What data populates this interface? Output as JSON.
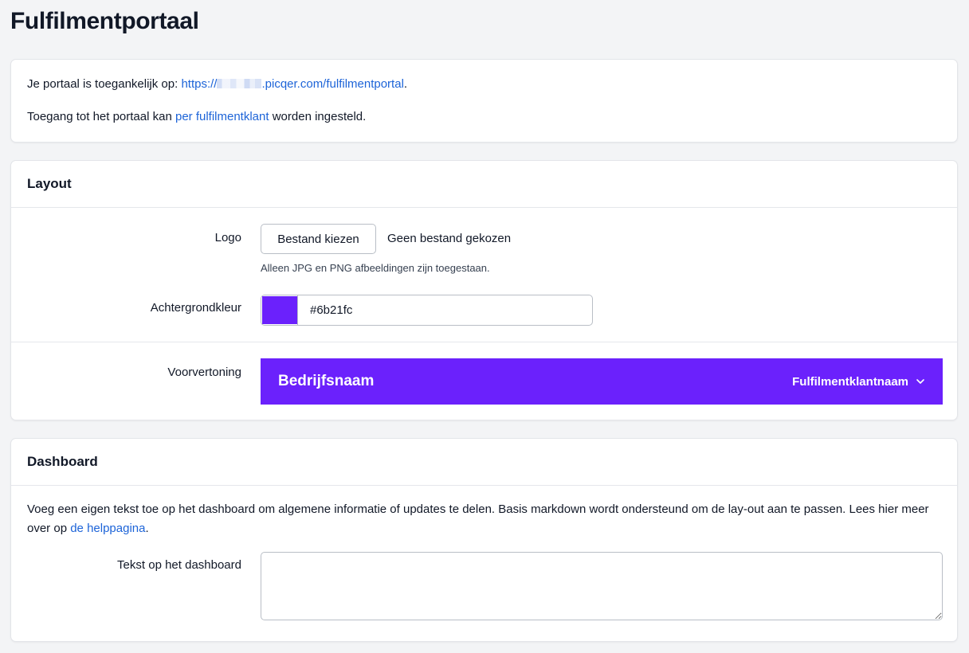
{
  "page": {
    "title": "Fulfilmentportaal"
  },
  "intro": {
    "line1_prefix": "Je portaal is toegankelijk op:",
    "url_start": "https://",
    "url_end": ".picqer.com/fulfilmentportal",
    "line1_suffix": ".",
    "line2_prefix": "Toegang tot het portaal kan",
    "line2_link": "per fulfilmentklant",
    "line2_suffix": "worden ingesteld."
  },
  "layout": {
    "header": "Layout",
    "logo_label": "Logo",
    "file_button_label": "Bestand kiezen",
    "file_status": "Geen bestand gekozen",
    "file_help": "Alleen JPG en PNG afbeeldingen zijn toegestaan.",
    "bg_color_label": "Achtergrondkleur",
    "bg_color_value": "#6b21fc",
    "preview_label": "Voorvertoning",
    "preview_company": "Bedrijfsnaam",
    "preview_client": "Fulfilmentklantnaam",
    "preview_client_icon": "chevron-down-icon"
  },
  "dashboard": {
    "header": "Dashboard",
    "description": "Voeg een eigen tekst toe op het dashboard om algemene informatie of updates te delen. Basis markdown wordt ondersteund om de lay-out aan te passen. Lees hier meer over op",
    "help_link": "de helppagina",
    "description_suffix": ".",
    "text_label": "Tekst op het dashboard",
    "text_value": ""
  },
  "colors": {
    "accent": "#6b21fc",
    "link": "#1d64d8",
    "background": "#f3f4f6"
  }
}
